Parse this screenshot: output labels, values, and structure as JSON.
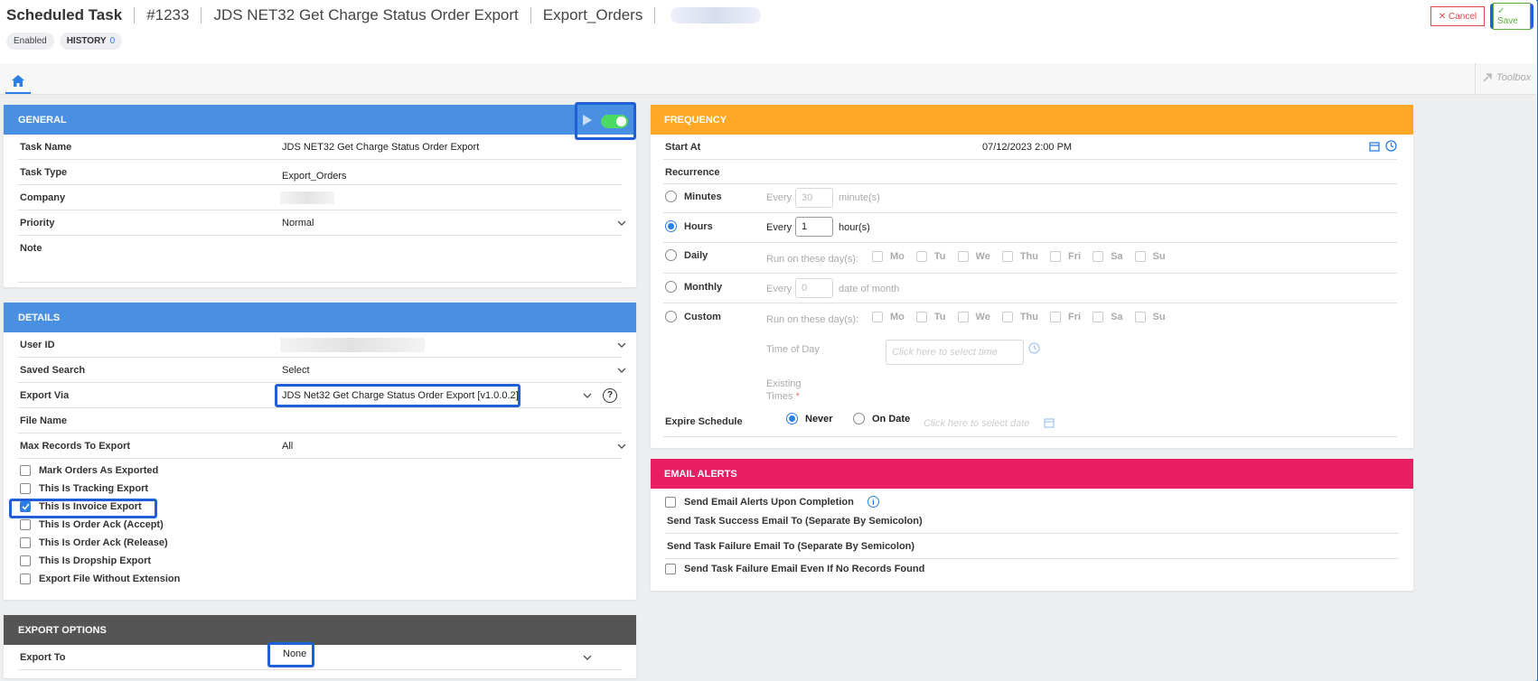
{
  "header": {
    "title": "Scheduled Task",
    "task_number": "#1233",
    "task_name": "JDS NET32 Get Charge Status Order Export",
    "task_type": "Export_Orders",
    "status_badge": "Enabled",
    "history_label": "HISTORY",
    "history_count": "0",
    "cancel_label": "✕ Cancel",
    "save_label": "✓ Save"
  },
  "tabbar": {
    "toolbox_label": "Toolbox"
  },
  "general": {
    "title": "GENERAL",
    "fields": [
      {
        "label": "Task Name",
        "value": "JDS NET32 Get Charge Status Order Export"
      },
      {
        "label": "Task Type",
        "value": "Export_Orders"
      },
      {
        "label": "Company",
        "value": ""
      },
      {
        "label": "Priority",
        "value": "Normal"
      },
      {
        "label": "Note",
        "value": ""
      }
    ]
  },
  "details": {
    "title": "DETAILS",
    "fields": [
      {
        "label": "User ID",
        "value": ""
      },
      {
        "label": "Saved Search",
        "value": "Select"
      },
      {
        "label": "Export Via",
        "value": "JDS Net32 Get Charge Status Order Export [v1.0.0.2]"
      },
      {
        "label": "File Name",
        "value": ""
      },
      {
        "label": "Max Records To Export",
        "value": "All"
      }
    ],
    "checkboxes": [
      {
        "label": "Mark Orders As Exported",
        "checked": false
      },
      {
        "label": "This Is Tracking Export",
        "checked": false
      },
      {
        "label": "This Is Invoice Export",
        "checked": true
      },
      {
        "label": "This Is Order Ack (Accept)",
        "checked": false
      },
      {
        "label": "This Is Order Ack (Release)",
        "checked": false
      },
      {
        "label": "This Is Dropship Export",
        "checked": false
      },
      {
        "label": "Export File Without Extension",
        "checked": false
      }
    ]
  },
  "export_options": {
    "title": "EXPORT OPTIONS",
    "export_to_label": "Export To",
    "export_to_value": "None"
  },
  "frequency": {
    "title": "FREQUENCY",
    "start_at_label": "Start At",
    "start_at_value": "07/12/2023 2:00 PM",
    "recurrence_label": "Recurrence",
    "every": "Every",
    "minutes": {
      "label": "Minutes",
      "value": "30",
      "unit": "minute(s)"
    },
    "hours": {
      "label": "Hours",
      "value": "1",
      "unit": "hour(s)"
    },
    "daily": {
      "label": "Daily",
      "run_label": "Run on these day(s):"
    },
    "monthly": {
      "label": "Monthly",
      "value": "0",
      "unit": "date of month"
    },
    "custom": {
      "label": "Custom",
      "run_label": "Run on these day(s):"
    },
    "days": [
      "Mo",
      "Tu",
      "We",
      "Thu",
      "Fri",
      "Sa",
      "Su"
    ],
    "time_of_day_label": "Time of Day",
    "time_placeholder": "Click here to select time",
    "existing_times_label": "Existing Times",
    "expire_label": "Expire Schedule",
    "never_label": "Never",
    "on_date_label": "On Date",
    "date_placeholder": "Click here to select date"
  },
  "email_alerts": {
    "title": "EMAIL ALERTS",
    "send_alerts_label": "Send Email Alerts Upon Completion",
    "success_label": "Send Task Success Email To (Separate By Semicolon)",
    "failure_label": "Send Task Failure Email To (Separate By Semicolon)",
    "failure_no_records_label": "Send Task Failure Email Even If No Records Found"
  },
  "colors": {
    "accent": "#2a7ee6",
    "general_header": "#4a90e2",
    "frequency_header": "#ffa726",
    "email_header": "#e91e63",
    "export_header": "#555555",
    "highlight": "#1f5fd8"
  }
}
